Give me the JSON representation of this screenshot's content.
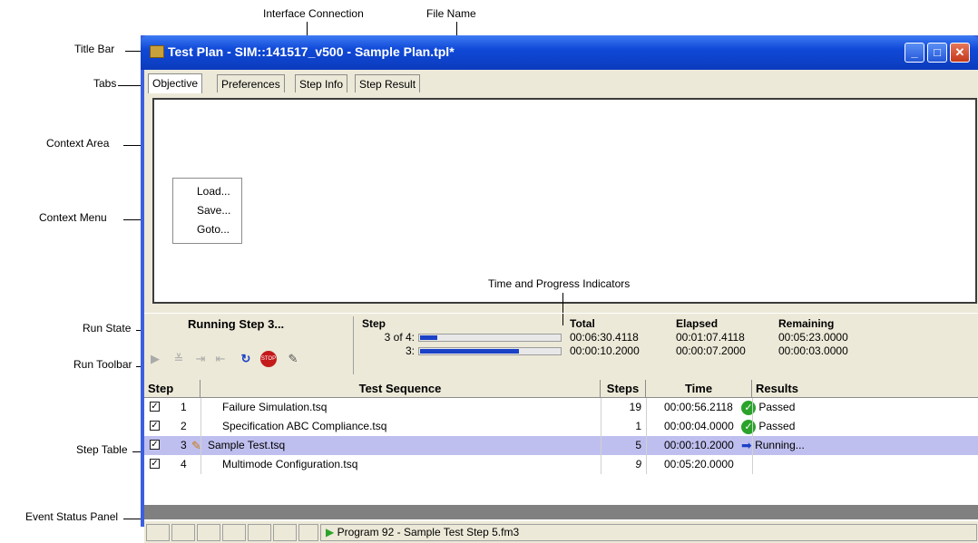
{
  "callouts": {
    "interface_connection": "Interface Connection",
    "file_name": "File Name",
    "title_bar": "Title Bar",
    "tabs": "Tabs",
    "context_area": "Context Area",
    "context_menu": "Context Menu",
    "time_progress": "Time and Progress Indicators",
    "run_state": "Run State",
    "run_toolbar": "Run Toolbar",
    "step_table": "Step Table",
    "event_status_panel": "Event Status Panel"
  },
  "window": {
    "title": "Test Plan - SIM::141517_v500 - Sample Plan.tpl*",
    "minimize": "_",
    "maximize": "□",
    "close": "✕"
  },
  "tabs": [
    "Objective",
    "Preferences",
    "Step Info",
    "Step Result"
  ],
  "context_menu": [
    "Load...",
    "Save...",
    "Goto..."
  ],
  "run": {
    "state": "Running Step 3...",
    "step_header": "Step",
    "total_header": "Total",
    "elapsed_header": "Elapsed",
    "remaining_header": "Remaining",
    "row1": {
      "label": "3 of 4:",
      "progress": 0.12,
      "total": "00:06:30.4118",
      "elapsed": "00:01:07.4118",
      "remaining": "00:05:23.0000"
    },
    "row2": {
      "label": "3:",
      "progress": 0.7,
      "total": "00:00:10.2000",
      "elapsed": "00:00:07.2000",
      "remaining": "00:00:03.0000"
    }
  },
  "toolbar_icons": [
    "run-icon",
    "step-into-icon",
    "step-forward-icon",
    "step-back-icon",
    "loop-icon",
    "stop-icon",
    "edit-icon"
  ],
  "table": {
    "headers": [
      "Step",
      "Test Sequence",
      "Steps",
      "Time",
      "Results"
    ],
    "rows": [
      {
        "step": "1",
        "sequence": "Failure Simulation.tsq",
        "steps": "19",
        "time": "00:00:56.2118",
        "result": "Passed",
        "status": "passed"
      },
      {
        "step": "2",
        "sequence": "Specification ABC Compliance.tsq",
        "steps": "1",
        "time": "00:00:04.0000",
        "result": "Passed",
        "status": "passed"
      },
      {
        "step": "3",
        "sequence": "Sample Test.tsq",
        "steps": "5",
        "time": "00:00:10.2000",
        "result": "Running...",
        "status": "running"
      },
      {
        "step": "4",
        "sequence": "Multimode Configuration.tsq",
        "steps": "9",
        "time": "00:05:20.0000",
        "result": "",
        "status": "pending"
      }
    ]
  },
  "status_bar": {
    "text": "Program 92 - Sample Test Step 5.fm3"
  }
}
